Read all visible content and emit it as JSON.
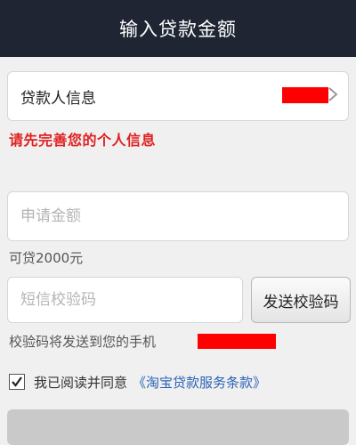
{
  "header": {
    "title": "输入贷款金额"
  },
  "borrower": {
    "label": "贷款人信息"
  },
  "warning": {
    "text": "请先完善您的个人信息"
  },
  "amount": {
    "placeholder": "申请金额",
    "value": ""
  },
  "available": {
    "text": "可贷2000元"
  },
  "sms": {
    "placeholder": "短信校验码",
    "button_label": "发送校验码"
  },
  "sent_note": {
    "text": "校验码将发送到您的手机"
  },
  "agreement": {
    "checked": true,
    "text": "我已阅读并同意",
    "link_text": "《淘宝贷款服务条款》"
  },
  "colors": {
    "header_bg": "#1f2533",
    "warning": "#e02020",
    "link": "#2a62b8",
    "redaction": "#ff0000"
  }
}
